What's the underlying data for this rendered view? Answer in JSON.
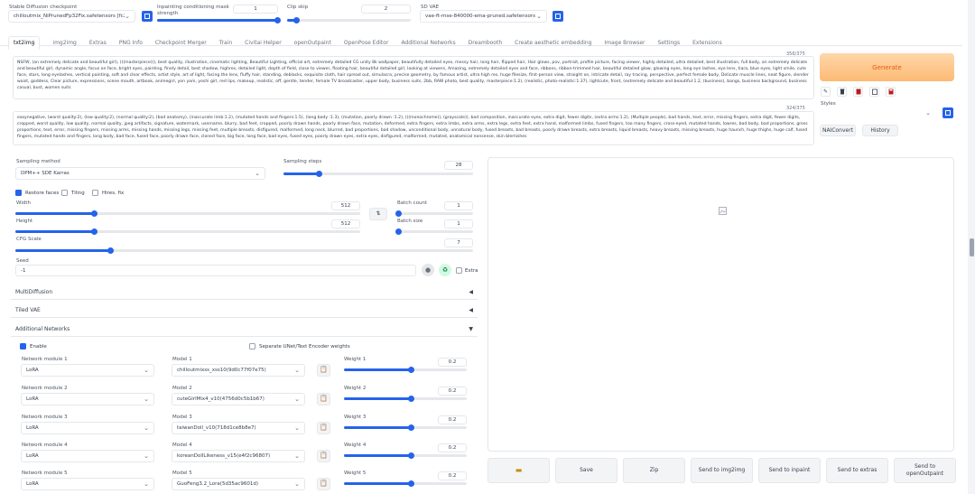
{
  "top": {
    "checkpoint_label": "Stable Diffusion checkpoint",
    "checkpoint_value": "chilloutmix_NiPrunedFp32Fix.safetensors [fc2511737a]",
    "mask_label": "Inpainting conditioning mask strength",
    "mask_value": "1",
    "mask_fill": 1.0,
    "clip_label": "Clip skip",
    "clip_value": "2",
    "clip_fill": 0.08,
    "vae_label": "SD VAE",
    "vae_value": "vae-ft-mse-840000-ema-pruned.safetensors"
  },
  "tabs": [
    "txt2img",
    "img2img",
    "Extras",
    "PNG Info",
    "Checkpoint Merger",
    "Train",
    "Civitai Helper",
    "openOutpaint",
    "OpenPose Editor",
    "Additional Networks",
    "Dreambooth",
    "Create aesthetic embedding",
    "Image Browser",
    "Settings",
    "Extensions"
  ],
  "prompt": {
    "counter": "356/375",
    "text": "NSFW, (an extremely delicate and beautiful girl), (((masterpiece))), best quality, illustration, cinematic lighting, Beautiful Lighting, official art, extremely detailed CG unity 8k wallpaper, beautifully detailed eyes, messy hair, long hair, flipped hair, Hair glows, pov, portrait, profile picture, facing viewer, highly detailed, ultra detailed, best illustration, full body, an extremely delicate and beautiful girl, dynamic angle, focus on face, bright eyes, painting, finely detail, best shadow, highres, detailed light, depth of field, close to viewer, floating hair, beautiful detailed girl, looking at viewers, Amazing, extremely detailed eyes and face, ribbons, ribbon-trimmed hair, beautiful detailed glow, glowing eyes, long eye lashes, eye lens, tiara, blue eyes, light smile, cute face, stars, long eyelashes, vertical painting, soft and clear effects, artist style, art of light, facing the lens, fluffy hair, standing, deblacks, exquisite cloth, hair spread out, simulacra, precise geometry, by famous artist, ultra high res, huge filesize, first-person view, straight on, intricate detail, ray tracing, perspective, perfect female body, Delicate muscle lines, neat figure, slender waist, goddess, Clear picture, expressions, scene mouth, artbook, animegirl, yon yam, yoshi girl, red lips, makeup, realistic, off, gentle, tender, female TV broadcaster, upper body, business suits, 2bb, RAW photo, best quality, masterpiece:1.2), (realistic, photo-realistic:1.37), lightcute, front, (extremely delicate and beautiful:1.2, (business), bangs, business background, business casual, bust, women suits"
  },
  "negative": {
    "counter": "324/375",
    "text": "easynegative, (worst quality:2), (low quality:2), (normal quality:2), (bad anatomy), (inaccurate limb:1.2), (mutated hands and fingers:1.5), (long body :1.3), (mutation, poorly drawn :1.2), (((monochrome)), (grayscale)), bad composition, inaccurate eyes, extra digit, fewer digits, (extra arms:1.2), (Multiple people), bad hands, text, error, missing fingers, extra digit, fewer digits, cropped, worst quality, low quality, normal quality, jpeg artifacts, signature, watermark, username, blurry, bad feet, cropped, poorly drawn hands, poorly drawn face, mutation, deformed, extra fingers, extra limbs, extra arms, extra legs, extra feet, extra hand, malformed limbs, fused fingers, too many fingers, cross-eyed, mutated hands, lowres, bad body, bad proportions, gross proportions, text, error, missing fingers, missing arms, missing hands, missing legs, missing feet, multiple breasts, disfigured, malformed, long neck, blurred, bad proportions, bad shadow, unconditional body, unnatural body, fused breasts, bad breasts, poorly drawn breasts, extra breasts, liquid breasts, heavy breasts, missing breasts, huge haunch, huge thighs, huge calf, fused fingers, mutated hands and fingers, long body, bad face, fused face, poorly drawn face, cloned face, big face, long face, bad eyes, fused eyes, poorly drawn eyes, extra eyes, disfigured, malformed, mutated, anatomical nonsense, skin blemishes"
  },
  "generate": {
    "generate_label": "Generate",
    "styles_label": "Styles",
    "naiconvert_label": "NAIConvert",
    "history_label": "History"
  },
  "sampling": {
    "method_label": "Sampling method",
    "method_value": "DPM++ SDE Karras",
    "steps_label": "Sampling steps",
    "steps_value": "28",
    "steps_fill": 0.19
  },
  "checks": {
    "restore_faces": "Restore faces",
    "tiling": "Tiling",
    "hires_fix": "Hires. fix"
  },
  "dims": {
    "width_label": "Width",
    "width_value": "512",
    "width_fill": 0.23,
    "height_label": "Height",
    "height_value": "512",
    "height_fill": 0.23,
    "swap_icon": "swap-icon",
    "batch_count_label": "Batch count",
    "batch_count_value": "1",
    "batch_count_fill": 0.02,
    "batch_size_label": "Batch size",
    "batch_size_value": "1",
    "batch_size_fill": 0.02
  },
  "cfg": {
    "label": "CFG Scale",
    "value": "7",
    "fill": 0.21
  },
  "seed": {
    "label": "Seed",
    "value": "-1",
    "extra_label": "Extra"
  },
  "sections": {
    "multidiffusion": "MultiDiffusion",
    "tiled_vae": "Tiled VAE",
    "additional_networks": "Additional Networks"
  },
  "addnet": {
    "enable_label": "Enable",
    "separate_label": "Separate UNet/Text Encoder weights",
    "modules": [
      {
        "module_label": "Network module 1",
        "module_value": "LoRA",
        "model_label": "Model 1",
        "model_value": "chilloutmixss_xss10(9d0c77f07e75)",
        "weight_label": "Weight 1",
        "weight_value": "0.2",
        "weight_fill": 0.55
      },
      {
        "module_label": "Network module 2",
        "module_value": "LoRA",
        "model_label": "Model 2",
        "model_value": "cuteGirlMix4_v10(4756d0c5b1b67)",
        "weight_label": "Weight 2",
        "weight_value": "0.2",
        "weight_fill": 0.55
      },
      {
        "module_label": "Network module 3",
        "module_value": "LoRA",
        "model_label": "Model 3",
        "model_value": "taiwanDoll_v10(718d1ce8b8e7)",
        "weight_label": "Weight 3",
        "weight_value": "0.2",
        "weight_fill": 0.55
      },
      {
        "module_label": "Network module 4",
        "module_value": "LoRA",
        "model_label": "Model 4",
        "model_value": "koreanDollLikeness_v15(e4f2c96807)",
        "weight_label": "Weight 4",
        "weight_value": "0.2",
        "weight_fill": 0.55
      },
      {
        "module_label": "Network module 5",
        "module_value": "LoRA",
        "model_label": "Model 5",
        "model_value": "GuoFeng3.2_Lora(5d35ac9601d)",
        "weight_label": "Weight 5",
        "weight_value": "0.2",
        "weight_fill": 0.55
      }
    ]
  },
  "output": {
    "image_icon": "broken-image-icon",
    "folder_icon": "folder-icon",
    "save_label": "Save",
    "zip_label": "Zip",
    "send_img2img": "Send to img2img",
    "send_inpaint": "Send to inpaint",
    "send_extras": "Send to extras",
    "send_openoutpaint": "Send to openOutpaint"
  },
  "colors": {
    "accent": "#2563eb",
    "generate": "#fdba74",
    "generate_text": "#ea580c"
  }
}
